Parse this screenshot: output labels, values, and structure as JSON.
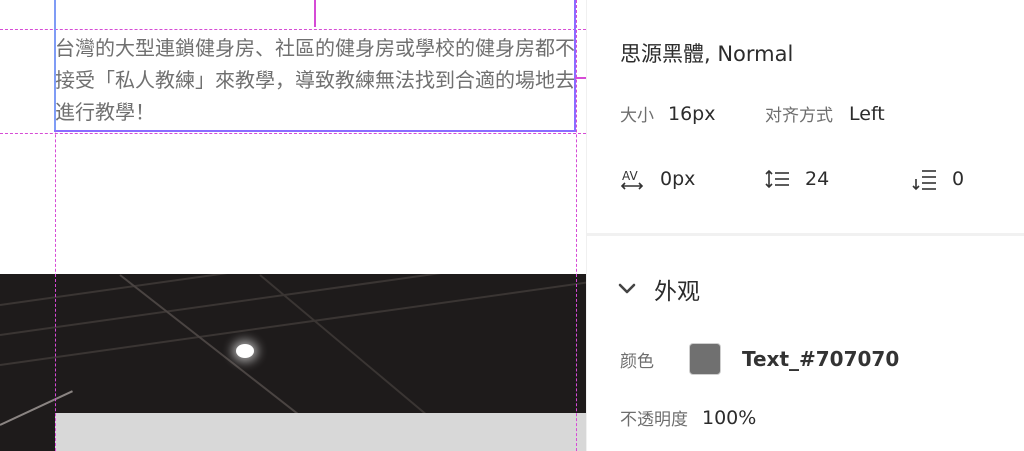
{
  "canvas": {
    "text": "台灣的大型連鎖健身房、社區的健身房或學校的健身房都不接受「私人教練」來教學，導致教練無法找到合適的場地去進行教學！"
  },
  "inspector": {
    "font_name": "思源黑體, Normal",
    "size_label": "大小",
    "size_value": "16px",
    "align_label": "对齐方式",
    "align_value": "Left",
    "char_spacing_icon": "letter-spacing-icon",
    "char_spacing_value": "0px",
    "line_spacing_icon": "line-height-icon",
    "line_spacing_value": "24",
    "para_spacing_icon": "paragraph-spacing-icon",
    "para_spacing_value": "0",
    "appearance": {
      "title": "外观",
      "color_label": "颜色",
      "color_name": "Text_#707070",
      "color_hex": "#707070",
      "opacity_label": "不透明度",
      "opacity_value": "100%"
    }
  }
}
